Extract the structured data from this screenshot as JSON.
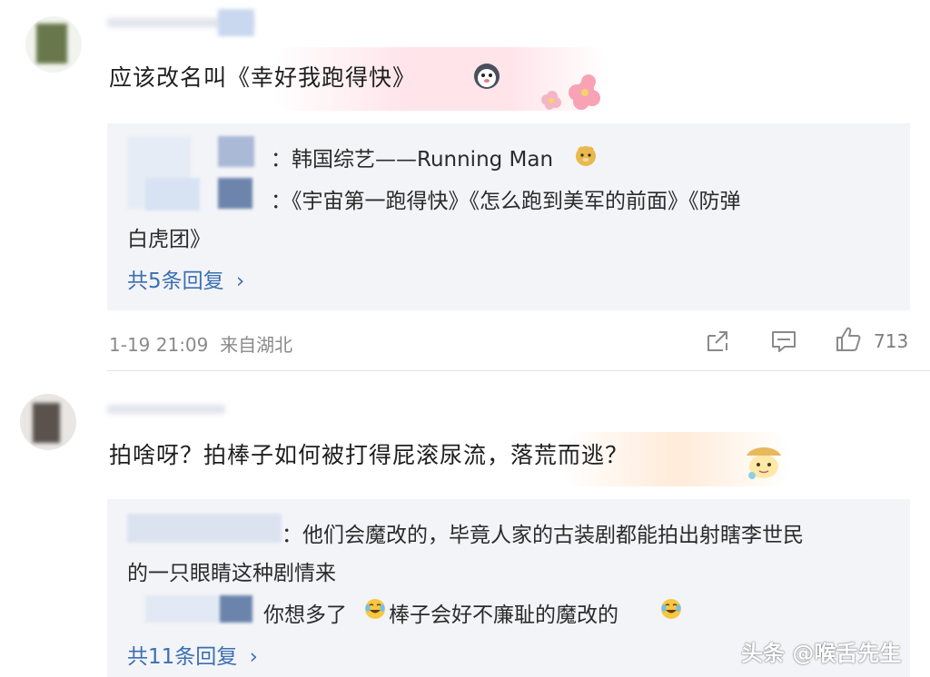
{
  "comments": [
    {
      "text": "应该改名叫《幸好我跑得快》",
      "replies": [
        "：韩国综艺——Running Man",
        "：《宇宙第一跑得快》《怎么跑到美军的前面》《防弹",
        "白虎团》"
      ],
      "reply_count_label": "共5条回复",
      "timestamp": "1-19 21:09",
      "location": "来自湖北",
      "like_count": "713"
    },
    {
      "text": "拍啥呀？拍棒子如何被打得屁滚尿流，落荒而逃？",
      "replies": [
        "：他们会魔改的，毕竟人家的古装剧都能拍出射瞎李世民",
        "的一只眼睛这种剧情来",
        "你想多了",
        "棒子会好不廉耻的魔改的"
      ],
      "reply_count_label": "共11条回复"
    }
  ],
  "icons": {
    "share": "share-icon",
    "comment": "comment-icon",
    "like": "thumbs-up-icon",
    "chevron": "chevron-right-icon"
  },
  "watermark": "头条 @喉舌先生",
  "colors": {
    "link": "#3b6fb3",
    "reply_bg": "#f3f4f7",
    "meta": "#8a8a8a"
  }
}
